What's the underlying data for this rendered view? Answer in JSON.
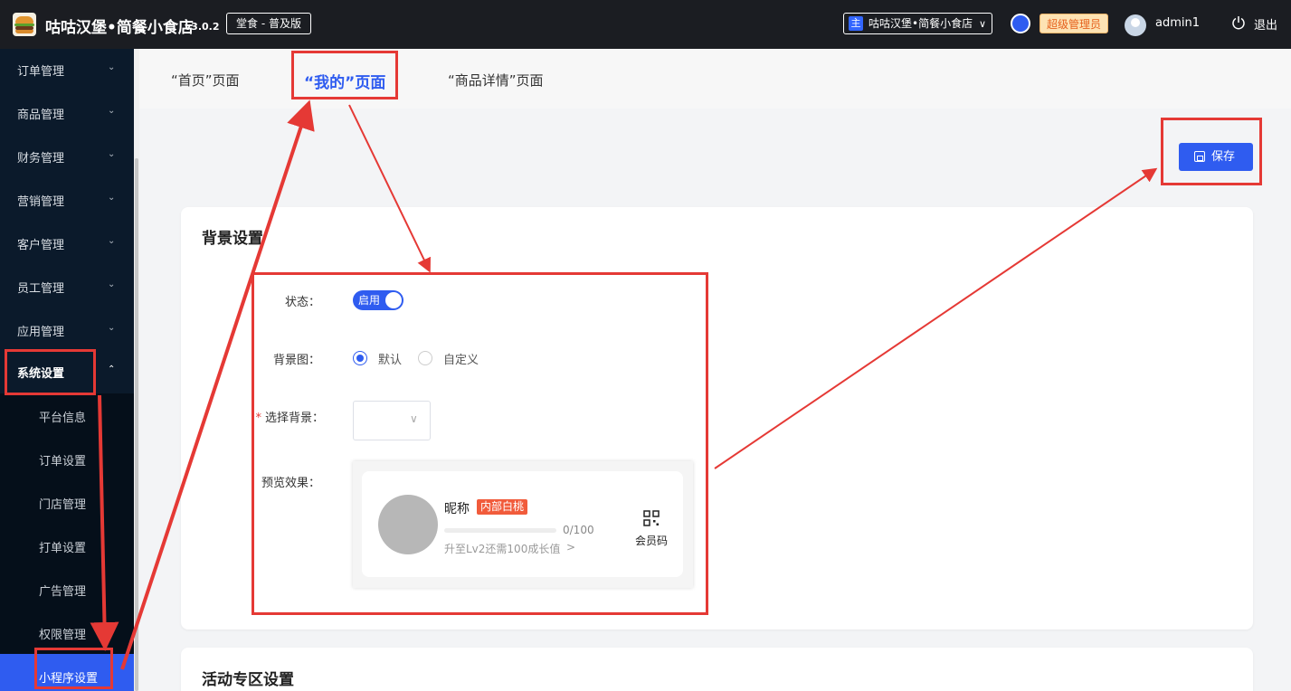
{
  "header": {
    "app_name": "咕咕汉堡•简餐小食店",
    "version": "v3.0.2",
    "edition": "堂食 - 普及版",
    "store_badge": "主",
    "store_name": "咕咕汉堡•简餐小食店",
    "role": "超级管理员",
    "username": "admin1",
    "logout": "退出"
  },
  "sidebar": {
    "items": [
      {
        "label": "订单管理"
      },
      {
        "label": "商品管理"
      },
      {
        "label": "财务管理"
      },
      {
        "label": "营销管理"
      },
      {
        "label": "客户管理"
      },
      {
        "label": "员工管理"
      },
      {
        "label": "应用管理"
      },
      {
        "label": "系统设置"
      }
    ],
    "sub_items": [
      {
        "label": "平台信息"
      },
      {
        "label": "订单设置"
      },
      {
        "label": "门店管理"
      },
      {
        "label": "打单设置"
      },
      {
        "label": "广告管理"
      },
      {
        "label": "权限管理"
      },
      {
        "label": "小程序设置"
      }
    ]
  },
  "tabs": [
    {
      "label": "“首页”页面"
    },
    {
      "label": "“我的”页面"
    },
    {
      "label": "“商品详情”页面"
    }
  ],
  "toolbar": {
    "save_label": "保存"
  },
  "background_settings": {
    "title": "背景设置",
    "status_label": "状态：",
    "status_value": "启用",
    "bg_image_label": "背景图：",
    "bg_options": [
      "默认",
      "自定义"
    ],
    "select_bg_label": "选择背景：",
    "preview_label": "预览效果：",
    "preview": {
      "nickname": "昵称",
      "tag": "内部白桃",
      "progress_text": "0/100",
      "progress_fraction": 0,
      "hint": "升至Lv2还需100成长值",
      "member_code": "会员码"
    }
  },
  "activity_settings": {
    "title": "活动专区设置"
  },
  "colors": {
    "accent": "#2f5cf0",
    "annotation": "#e53935",
    "tag": "#f15b3b",
    "topbar": "#1b1d22",
    "sidebar": "#0b1a2b"
  }
}
